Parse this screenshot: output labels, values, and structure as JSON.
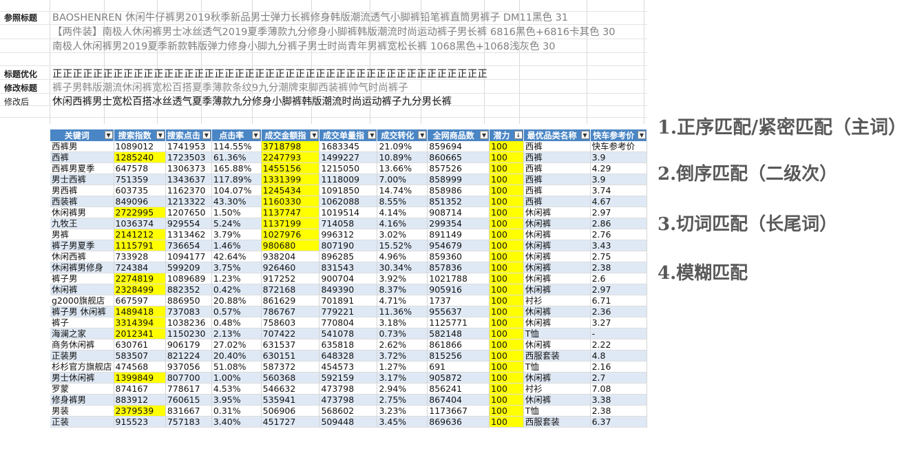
{
  "labels": {
    "reference": "参照标题",
    "optimize": "标题优化",
    "modify": "修改标题",
    "after": "修改后"
  },
  "reference_titles": [
    "BAOSHENREN 休闲牛仔裤男2019秋季新品男士弹力长裤修身韩版潮流透气小脚裤铅笔裤直筒男裤子 DM11黑色 31",
    "【两件装】南极人休闲裤男士冰丝透气2019夏季薄款九分修身小脚裤韩版潮流时尚运动裤子男长裤 6816黑色+6816卡其色 30",
    "南极人休闲裤男2019夏季新款韩版弹力修身小脚九分裤子男士时尚青年男裤宽松长裤 1068黑色+1068浅灰色 30"
  ],
  "optimize_marks": "正正正正正正正正正正正正正正正正正正正正正正正正正正正正正正正正正正正正正正正正正正正",
  "modified_title": "裤子男韩版潮流休闲裤宽松百搭夏季薄款条纹9九分潮牌束脚西装裤帅气时尚裤子",
  "after_title": "休闲西裤男士宽松百搭冰丝透气夏季薄款九分修身小脚裤韩版潮流时尚运动裤子九分男长裤",
  "table": {
    "headers": [
      "关键词",
      "搜索指数",
      "搜索点击",
      "点击率",
      "成交金额指",
      "成交单量指",
      "成交转化",
      "全网商品数",
      "潜力",
      "最优品类名称",
      "快车参考价"
    ],
    "rows": [
      {
        "cells": [
          "西裤男",
          "1089012",
          "1741953",
          "114.55%",
          "3718798",
          "1683345",
          "21.09%",
          "859694",
          "100",
          "西裤",
          "快车参考价"
        ],
        "hl": [
          4
        ]
      },
      {
        "cells": [
          "西裤",
          "1285240",
          "1723503",
          "61.36%",
          "2247793",
          "1499227",
          "10.89%",
          "860665",
          "100",
          "西裤",
          "3.9"
        ],
        "hl": [
          1,
          4
        ]
      },
      {
        "cells": [
          "西裤男夏季",
          "647578",
          "1306373",
          "165.88%",
          "1455156",
          "1215050",
          "13.66%",
          "857526",
          "100",
          "西裤",
          "4.29"
        ],
        "hl": [
          4
        ]
      },
      {
        "cells": [
          "男士西裤",
          "751359",
          "1343637",
          "117.89%",
          "1331399",
          "1118009",
          "7.00%",
          "858999",
          "100",
          "西裤",
          "3.9"
        ],
        "hl": [
          4
        ]
      },
      {
        "cells": [
          "男西裤",
          "603735",
          "1162370",
          "104.07%",
          "1245434",
          "1091850",
          "14.74%",
          "858986",
          "100",
          "西裤",
          "3.74"
        ],
        "hl": [
          4
        ]
      },
      {
        "cells": [
          "西装裤",
          "849096",
          "1213322",
          "43.30%",
          "1160330",
          "1062088",
          "8.55%",
          "851352",
          "100",
          "西裤",
          "4.67"
        ],
        "hl": [
          4
        ]
      },
      {
        "cells": [
          "休闲裤男",
          "2722995",
          "1207650",
          "1.50%",
          "1137747",
          "1019514",
          "4.14%",
          "908714",
          "100",
          "休闲裤",
          "2.97"
        ],
        "hl": [
          1,
          4
        ]
      },
      {
        "cells": [
          "九牧王",
          "1036374",
          "929554",
          "5.24%",
          "1137199",
          "714058",
          "4.16%",
          "299354",
          "100",
          "休闲裤",
          "2.86"
        ],
        "hl": [
          4
        ]
      },
      {
        "cells": [
          "男裤",
          "2141212",
          "1313462",
          "3.79%",
          "1027976",
          "996312",
          "3.02%",
          "891149",
          "100",
          "休闲裤",
          "2.76"
        ],
        "hl": [
          1,
          4
        ]
      },
      {
        "cells": [
          "裤子男夏季",
          "1115791",
          "736654",
          "1.46%",
          "980680",
          "807190",
          "15.52%",
          "954679",
          "100",
          "休闲裤",
          "3.43"
        ],
        "hl": [
          1,
          4
        ]
      },
      {
        "cells": [
          "休闲西裤",
          "733928",
          "1094177",
          "42.64%",
          "938204",
          "896285",
          "4.96%",
          "859360",
          "100",
          "休闲裤",
          "2.75"
        ],
        "hl": []
      },
      {
        "cells": [
          "休闲裤男修身",
          "724384",
          "599209",
          "3.75%",
          "926460",
          "831543",
          "30.34%",
          "857836",
          "100",
          "休闲裤",
          "2.38"
        ],
        "hl": []
      },
      {
        "cells": [
          "裤子男",
          "2274819",
          "1089689",
          "1.23%",
          "917252",
          "900704",
          "3.92%",
          "1021788",
          "100",
          "休闲裤",
          "2.6"
        ],
        "hl": [
          1
        ]
      },
      {
        "cells": [
          "休闲裤",
          "2328499",
          "882352",
          "0.42%",
          "872168",
          "849390",
          "8.37%",
          "905916",
          "100",
          "休闲裤",
          "2.97"
        ],
        "hl": [
          1
        ]
      },
      {
        "cells": [
          "g2000旗舰店",
          "667597",
          "886950",
          "20.88%",
          "861629",
          "701891",
          "4.71%",
          "1737",
          "100",
          "衬衫",
          "6.71"
        ],
        "hl": []
      },
      {
        "cells": [
          "裤子男 休闲裤",
          "1489418",
          "737083",
          "0.57%",
          "786767",
          "779221",
          "11.36%",
          "955637",
          "100",
          "休闲裤",
          "2.36"
        ],
        "hl": [
          1
        ]
      },
      {
        "cells": [
          "裤子",
          "3314394",
          "1038236",
          "0.48%",
          "758603",
          "770804",
          "3.18%",
          "1125771",
          "100",
          "休闲裤",
          "3.27"
        ],
        "hl": [
          1
        ]
      },
      {
        "cells": [
          "海澜之家",
          "2012341",
          "1150230",
          "2.13%",
          "707422",
          "541078",
          "0.73%",
          "582148",
          "100",
          "T恤",
          "-"
        ],
        "hl": [
          1
        ]
      },
      {
        "cells": [
          "商务休闲裤",
          "630761",
          "906179",
          "27.02%",
          "631537",
          "635818",
          "2.62%",
          "861866",
          "100",
          "休闲裤",
          "2.22"
        ],
        "hl": []
      },
      {
        "cells": [
          "正装男",
          "583507",
          "821224",
          "20.40%",
          "630151",
          "648328",
          "3.72%",
          "815256",
          "100",
          "西服套装",
          "4.8"
        ],
        "hl": []
      },
      {
        "cells": [
          "杉杉官方旗舰店",
          "474568",
          "937056",
          "51.08%",
          "587372",
          "454573",
          "1.27%",
          "691",
          "100",
          "T恤",
          "2.16"
        ],
        "hl": []
      },
      {
        "cells": [
          "男士休闲裤",
          "1399849",
          "807700",
          "1.00%",
          "560368",
          "592159",
          "3.17%",
          "905872",
          "100",
          "休闲裤",
          "2.7"
        ],
        "hl": [
          1
        ]
      },
      {
        "cells": [
          "罗蒙",
          "874167",
          "778617",
          "4.53%",
          "546632",
          "473798",
          "2.94%",
          "856241",
          "100",
          "衬衫",
          "7.08"
        ],
        "hl": []
      },
      {
        "cells": [
          "修身裤男",
          "883912",
          "760615",
          "3.95%",
          "535941",
          "473798",
          "2.75%",
          "867404",
          "100",
          "休闲裤",
          "3.38"
        ],
        "hl": []
      },
      {
        "cells": [
          "男装",
          "2379539",
          "831667",
          "0.31%",
          "506906",
          "568602",
          "3.23%",
          "1173667",
          "100",
          "T恤",
          "2.38"
        ],
        "hl": [
          1
        ]
      },
      {
        "cells": [
          "正装",
          "915523",
          "757183",
          "3.40%",
          "451727",
          "509448",
          "3.45%",
          "869636",
          "100",
          "西服套装",
          "6.37"
        ],
        "hl": []
      }
    ]
  },
  "methods": [
    "1.正序匹配/紧密匹配（主词）",
    "2.倒序匹配（二级次）",
    "3.切词匹配（长尾词）",
    "4.模糊匹配"
  ],
  "colors": {
    "header_bg": "#4a86c5",
    "highlight": "#ffff00",
    "band": "#dfe9f5"
  }
}
